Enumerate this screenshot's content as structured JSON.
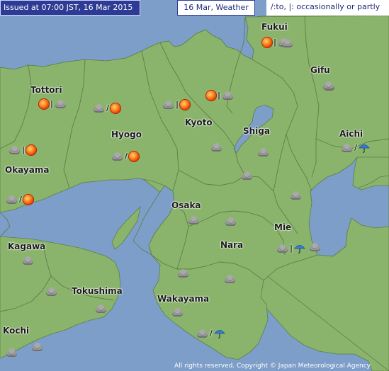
{
  "header": {
    "issued": "Issued at 07:00 JST, 16 Mar 2015",
    "date_label": "16 Mar, Weather",
    "legend": "/:to, |: occasionally or partly"
  },
  "colors": {
    "sea": "#7c9ec8",
    "land": "#8ab46c",
    "lake": "#7c9ec8",
    "header_bg": "#2d3b95"
  },
  "icons": {
    "sunny": "sun-icon",
    "cloudy": "cloud-icon",
    "rain": "umbrella-icon"
  },
  "prefectures": {
    "fukui": "Fukui",
    "gifu": "Gifu",
    "tottori": "Tottori",
    "kyoto": "Kyoto",
    "hyogo": "Hyogo",
    "shiga": "Shiga",
    "aichi": "Aichi",
    "okayama": "Okayama",
    "osaka": "Osaka",
    "mie": "Mie",
    "nara": "Nara",
    "kagawa": "Kagawa",
    "tokushima": "Tokushima",
    "wakayama": "Wakayama",
    "kochi": "Kochi"
  },
  "forecasts": [
    {
      "id": "fukui-north",
      "icons": [
        "sunny",
        "cloudy"
      ],
      "sep": "|"
    },
    {
      "id": "kyoto-north-east",
      "icons": [
        "sunny",
        "cloudy"
      ],
      "sep": "|"
    },
    {
      "id": "kyoto-north",
      "icons": [
        "cloudy",
        "sunny"
      ],
      "sep": "|"
    },
    {
      "id": "tottori",
      "icons": [
        "sunny",
        "cloudy"
      ],
      "sep": "|"
    },
    {
      "id": "hyogo-north",
      "icons": [
        "cloudy",
        "sunny"
      ],
      "sep": "/"
    },
    {
      "id": "okayama-north",
      "icons": [
        "cloudy",
        "sunny"
      ],
      "sep": "|"
    },
    {
      "id": "hyogo-south",
      "icons": [
        "cloudy",
        "sunny"
      ],
      "sep": "/"
    },
    {
      "id": "okayama-south",
      "icons": [
        "cloudy",
        "sunny"
      ],
      "sep": "/"
    },
    {
      "id": "aichi-east",
      "icons": [
        "cloudy",
        "rain"
      ],
      "sep": "/"
    },
    {
      "id": "mie-south",
      "icons": [
        "cloudy",
        "rain"
      ],
      "sep": "|"
    },
    {
      "id": "wakayama-south",
      "icons": [
        "cloudy",
        "rain"
      ],
      "sep": "/"
    }
  ],
  "single_icons": [
    {
      "id": "fukui-south",
      "icon": "cloudy"
    },
    {
      "id": "gifu",
      "icon": "cloudy"
    },
    {
      "id": "kyoto-south",
      "icon": "cloudy"
    },
    {
      "id": "shiga-north",
      "icon": "cloudy"
    },
    {
      "id": "shiga-south",
      "icon": "cloudy"
    },
    {
      "id": "aichi-west",
      "icon": "cloudy"
    },
    {
      "id": "mie-north",
      "icon": "cloudy"
    },
    {
      "id": "osaka",
      "icon": "cloudy"
    },
    {
      "id": "nara-north",
      "icon": "cloudy"
    },
    {
      "id": "nara-south",
      "icon": "cloudy"
    },
    {
      "id": "mie-central",
      "icon": "cloudy"
    },
    {
      "id": "kagawa",
      "icon": "cloudy"
    },
    {
      "id": "tokushima-north",
      "icon": "cloudy"
    },
    {
      "id": "tokushima-south",
      "icon": "cloudy"
    },
    {
      "id": "wakayama-north",
      "icon": "cloudy"
    },
    {
      "id": "wakayama-central",
      "icon": "cloudy"
    },
    {
      "id": "kochi-east",
      "icon": "cloudy"
    },
    {
      "id": "kochi-west",
      "icon": "cloudy"
    }
  ],
  "footer": {
    "copyright": "All rights reserved. Copyright © Japan Meteorological Agency"
  }
}
